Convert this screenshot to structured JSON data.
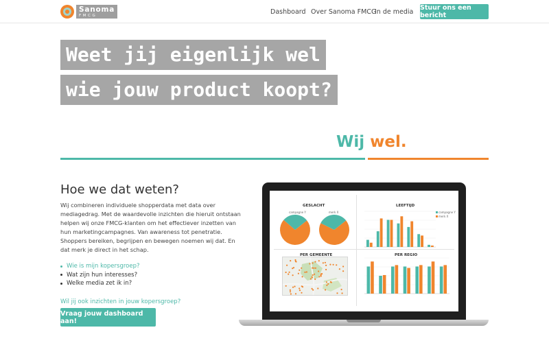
{
  "header": {
    "logo": {
      "name": "Sanoma",
      "sub": "FMCG"
    },
    "nav": [
      "Dashboard",
      "Over Sanoma FMCG",
      "In de media"
    ],
    "cta": "Stuur ons een bericht"
  },
  "hero": {
    "line1": "Weet jij eigenlijk wel",
    "line2": "wie jouw product koopt?",
    "wij": "Wij",
    "wel": "wel."
  },
  "content": {
    "heading": "Hoe we dat weten?",
    "paragraph": "Wij combineren individuele shopperdata met data over mediagedrag. Met de waardevolle inzichten die hieruit ontstaan helpen wij onze FMCG-klanten om het effectiever inzetten van hun marketingcampagnes. Van awareness tot penetratie. Shoppers bereiken, begrijpen en bewegen noemen wij dat. En dat merk je direct in het schap.",
    "list": [
      "Wie is mijn kopersgroep?",
      "Wat zijn hun interesses?",
      "Welke media zet ik in?"
    ],
    "question": "Wil jij ook inzichten in jouw kopersgroep?",
    "cta": "Vraag jouw dashboard aan!"
  },
  "dashboard": {
    "panels": [
      "GESLACHT",
      "LEEFTIJD",
      "PER GEMEENTE",
      "PER REGIO"
    ],
    "pie_labels": [
      "campagne Y",
      "merk X"
    ],
    "legend": [
      "campagne Y",
      "merk X"
    ],
    "colors": {
      "teal": "#4db8a8",
      "orange": "#f0852d",
      "grey": "#a6a6a6"
    }
  },
  "chart_data": [
    {
      "type": "pie",
      "title": "GESLACHT",
      "series": [
        {
          "name": "campagne Y",
          "values": [
            72,
            28
          ]
        },
        {
          "name": "merk X",
          "values": [
            68,
            32
          ]
        }
      ]
    },
    {
      "type": "bar",
      "title": "LEEFTIJD",
      "series": [
        {
          "name": "campagne Y",
          "values": [
            10,
            22,
            38,
            33,
            28,
            18,
            3
          ]
        },
        {
          "name": "merk X",
          "values": [
            6,
            40,
            38,
            43,
            36,
            16,
            2
          ]
        }
      ]
    },
    {
      "type": "bar",
      "title": "PER REGIO",
      "series": [
        {
          "name": "campagne Y",
          "values": [
            38,
            25,
            38,
            38,
            38,
            38,
            38
          ]
        },
        {
          "name": "merk X",
          "values": [
            45,
            26,
            40,
            36,
            40,
            45,
            40
          ]
        }
      ]
    }
  ]
}
